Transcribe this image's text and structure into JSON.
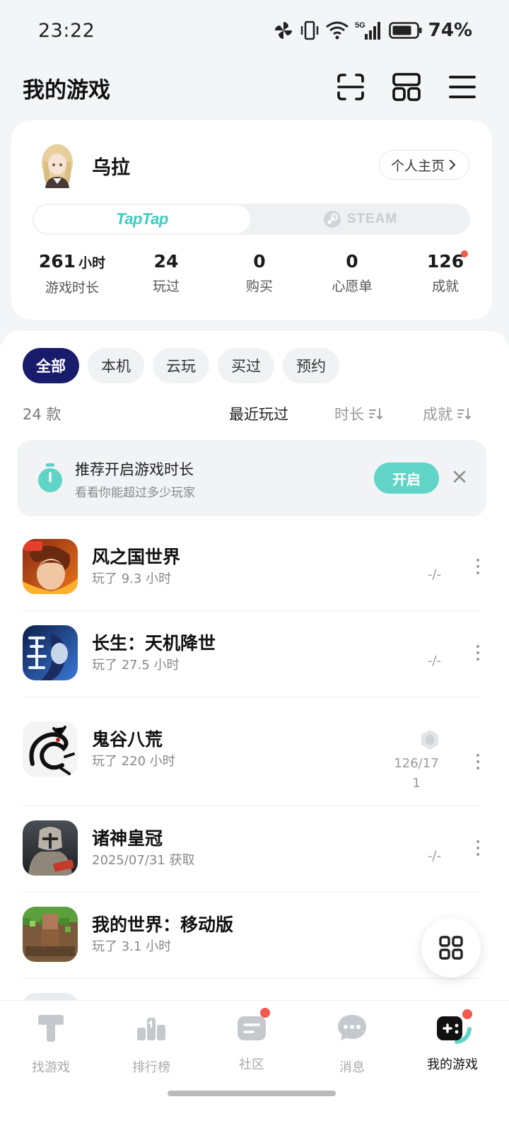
{
  "status_bar": {
    "time": "23:22",
    "battery": "74%"
  },
  "header": {
    "title": "我的游戏"
  },
  "profile": {
    "username": "乌拉",
    "profile_button": "个人主页",
    "platforms": [
      "TapTap",
      "STEAM"
    ],
    "stats": [
      {
        "value": "261",
        "unit": "小时",
        "label": "游戏时长"
      },
      {
        "value": "24",
        "unit": "",
        "label": "玩过"
      },
      {
        "value": "0",
        "unit": "",
        "label": "购买"
      },
      {
        "value": "0",
        "unit": "",
        "label": "心愿单"
      },
      {
        "value": "126",
        "unit": "",
        "label": "成就"
      }
    ]
  },
  "filters": [
    "全部",
    "本机",
    "云玩",
    "买过",
    "预约"
  ],
  "list": {
    "count": "24 款",
    "sort_options": [
      "最近玩过",
      "时长",
      "成就"
    ]
  },
  "recommendation": {
    "title": "推荐开启游戏时长",
    "subtitle": "看看你能超过多少玩家",
    "button": "开启"
  },
  "games": [
    {
      "name": "风之国世界",
      "subtitle": "玩了 9.3 小时",
      "achievement": "-/-"
    },
    {
      "name": "长生：天机降世",
      "subtitle": "玩了 27.5 小时",
      "achievement": "-/-"
    },
    {
      "name": "鬼谷八荒",
      "subtitle": "玩了 220 小时",
      "achievement": "126/171"
    },
    {
      "name": "诸神皇冠",
      "subtitle": "2025/07/31 获取",
      "achievement": "-/-"
    },
    {
      "name": "我的世界：移动版",
      "subtitle": "玩了 3.1 小时",
      "achievement": ""
    }
  ],
  "bottom_nav": [
    {
      "label": "找游戏",
      "icon": "taptap-icon"
    },
    {
      "label": "排行榜",
      "icon": "ranking-icon"
    },
    {
      "label": "社区",
      "icon": "community-icon"
    },
    {
      "label": "消息",
      "icon": "message-icon"
    },
    {
      "label": "我的游戏",
      "icon": "my-games-icon"
    }
  ],
  "colors": {
    "accent": "#5fd4c7",
    "chip_active": "#191b6b",
    "badge": "#f0594c"
  }
}
